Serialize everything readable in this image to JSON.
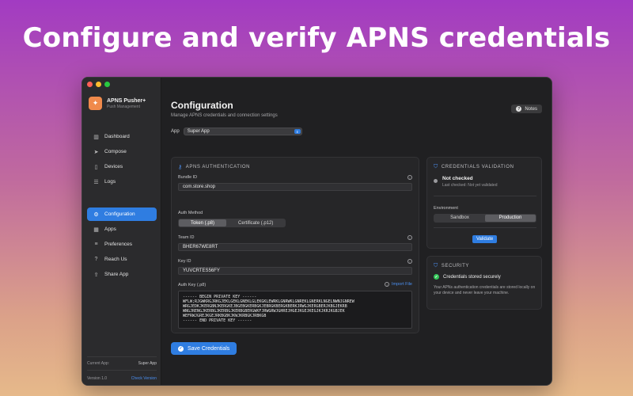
{
  "headline": "Configure and verify APNS credentials",
  "app": {
    "name": "APNS Pusher+",
    "subtitle": "Push Management"
  },
  "sidebar": {
    "group1": [
      {
        "label": "Dashboard",
        "icon": "chart-bar-icon"
      },
      {
        "label": "Compose",
        "icon": "paper-plane-icon"
      },
      {
        "label": "Devices",
        "icon": "phone-icon"
      },
      {
        "label": "Logs",
        "icon": "list-icon"
      }
    ],
    "group2": [
      {
        "label": "Configuration",
        "icon": "gear-icon",
        "active": true
      },
      {
        "label": "Apps",
        "icon": "grid-icon"
      },
      {
        "label": "Preferences",
        "icon": "sliders-icon"
      },
      {
        "label": "Reach Us",
        "icon": "question-icon"
      },
      {
        "label": "Share App",
        "icon": "share-icon"
      }
    ],
    "current_app_label": "Current App:",
    "current_app_value": "Super App",
    "version": "Version 1.0",
    "check_version": "Check Version"
  },
  "main": {
    "title": "Configuration",
    "subtitle": "Manage APNS credentials and connection settings",
    "notes_label": "Notes",
    "app_label": "App",
    "app_selected": "Super App"
  },
  "auth": {
    "heading": "APNS AUTHENTICATION",
    "bundle_label": "Bundle ID",
    "bundle_value": "com.store.shop",
    "method_label": "Auth Method",
    "method_options": [
      "Token (.p8)",
      "Certificate (.p12)"
    ],
    "team_label": "Team ID",
    "team_value": "BHER67WE8RT",
    "key_label": "Key ID",
    "key_value": "YUVCRTES56FY",
    "authkey_label": "Auth Key (.p8)",
    "import_label": "Import File",
    "authkey_value": "------ BEGIN PRIVATE KEY ------\nWFLW;RJGWKRGJRKGJEKLGEKLGNEKLGLEKGKLEWRKLGNRWKLGNREKLGNERKLNGELNWNJGNREW\nWRGJEDKJKERGBNJKERGKEJBGEBGKERBGKJEBRGKBERGKBERKJRWGJKERGBERJKBGJEKRB\nWNGJRENGJKERBGJKERBGJKERBGBERGWKFJRWGRWJGHREJHGEJKGEJKEGJKJKRJKGBJEK\nWEFRWJGREJKGEJRKBGBKJKWJKRBGKJRBKGB\n------ END PRIVATE KEY ------",
    "save_label": "Save Credentials"
  },
  "validation": {
    "heading": "CREDENTIALS VALIDATION",
    "status_title": "Not checked",
    "status_sub": "Last checked: Not yet validated",
    "env_label": "Environment",
    "env_options": [
      "Sandbox",
      "Production"
    ],
    "validate_label": "Validate"
  },
  "security": {
    "heading": "SECURITY",
    "ok_label": "Credentials stored securely",
    "description": "Your APNs authentication credentials are stored locally on your device and never leave your machine."
  },
  "colors": {
    "accent": "#2f7de1",
    "success": "#34c759",
    "brand": "#f08a4b"
  }
}
